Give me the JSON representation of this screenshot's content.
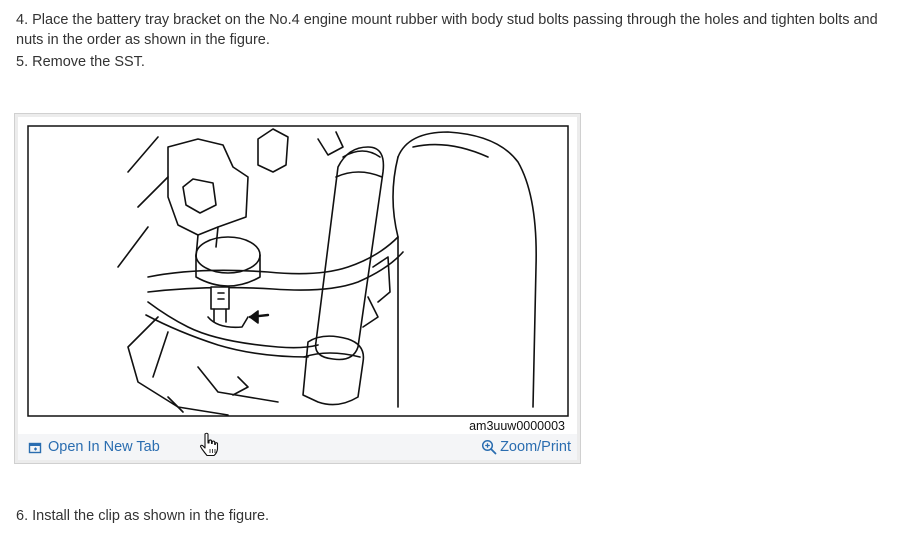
{
  "steps": {
    "step4": "4. Place the battery tray bracket on the No.4 engine mount rubber with body stud bolts passing through the holes and tighten bolts and nuts in the order as shown in the figure.",
    "step5": "5. Remove the SST.",
    "step6": "6. Install the clip as shown in the figure."
  },
  "figure": {
    "code": "am3uuw0000003",
    "open_in_new_tab": "Open In New Tab",
    "zoom_print": "Zoom/Print"
  },
  "colors": {
    "link": "#2a6db0",
    "text": "#333333",
    "frame_bg": "#ececec"
  },
  "icons": {
    "open_tab": "open-new-tab-icon",
    "zoom": "zoom-in-icon",
    "cursor": "hand-cursor-icon"
  }
}
